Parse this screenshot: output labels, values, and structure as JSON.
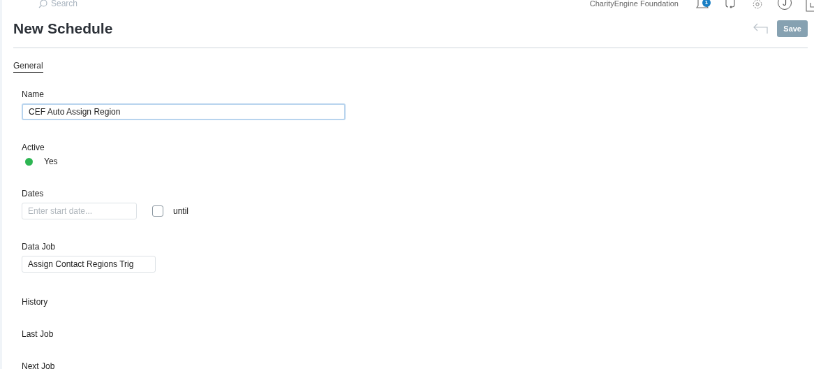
{
  "topbar": {
    "search": {
      "placeholder": "Search"
    },
    "organization": "CharityEngine Foundation",
    "notifications": {
      "count": "1"
    },
    "avatar": "J"
  },
  "header": {
    "title": "New Schedule",
    "save": {
      "label": "Save",
      "disabled": true
    }
  },
  "tabs": [
    {
      "label": "General",
      "selected": true
    }
  ],
  "form": {
    "name": {
      "label": "Name",
      "value": "CEF Auto Assign Region",
      "focused": true
    },
    "active": {
      "label": "Active",
      "value": "Yes",
      "on": true
    },
    "dates": {
      "label": "Dates",
      "placeholder": "Enter start date...",
      "until": {
        "label": "until",
        "checked": false
      }
    },
    "data_job": {
      "label": "Data Job",
      "value": "Assign Contact Regions Trig"
    },
    "sections": [
      {
        "label": "History"
      },
      {
        "label": "Last Job"
      },
      {
        "label": "Next Job"
      }
    ]
  }
}
